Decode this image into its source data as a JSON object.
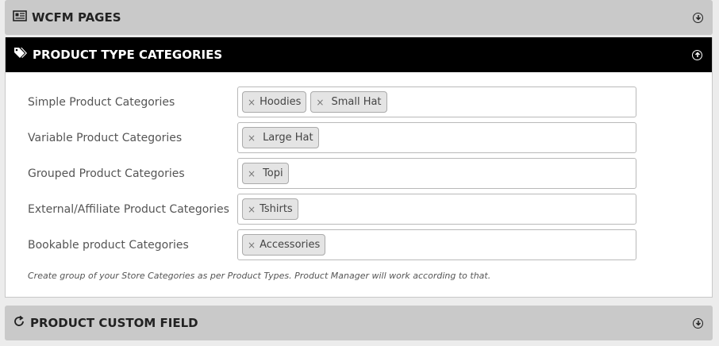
{
  "sections": {
    "wcfm_pages": {
      "title": "WCFM PAGES",
      "icon": "newspaper-icon"
    },
    "product_type_categories": {
      "title": "PRODUCT TYPE CATEGORIES",
      "icon": "tags-icon",
      "rows": [
        {
          "label": "Simple Product Categories",
          "tags": [
            "Hoodies",
            "Small Hat"
          ]
        },
        {
          "label": "Variable Product Categories",
          "tags": [
            "Large Hat"
          ]
        },
        {
          "label": "Grouped Product Categories",
          "tags": [
            "Topi"
          ]
        },
        {
          "label": "External/Affiliate Product Categories",
          "tags": [
            "Tshirts"
          ]
        },
        {
          "label": "Bookable product Categories",
          "tags": [
            "Accessories"
          ]
        }
      ],
      "hint": "Create group of your Store Categories as per Product Types. Product Manager will work according to that."
    },
    "product_custom_field": {
      "title": "PRODUCT CUSTOM FIELD",
      "icon": "refresh-icon"
    }
  },
  "tag_remove_symbol": "×",
  "colors": {
    "active_header": "#000000",
    "inactive_header": "#c9c9c9"
  }
}
